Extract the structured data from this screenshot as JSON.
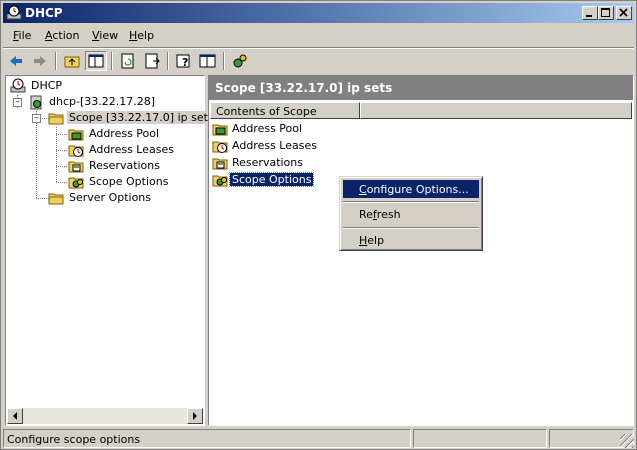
{
  "window": {
    "title": "DHCP"
  },
  "menu": [
    {
      "label": "File",
      "key": "F",
      "rest": "ile"
    },
    {
      "label": "Action",
      "key": "A",
      "rest": "ction"
    },
    {
      "label": "View",
      "key": "V",
      "rest": "iew"
    },
    {
      "label": "Help",
      "key": "H",
      "rest": "elp"
    }
  ],
  "toolbar": {
    "buttons": [
      "back-icon",
      "forward-icon",
      "up-folder-icon",
      "show-hide-tree-icon",
      "refresh-icon",
      "export-list-icon",
      "help-icon",
      "properties-icon",
      "dhcp-server-icon"
    ]
  },
  "tree": {
    "root": "DHCP",
    "server": "dhcp-[33.22.17.28]",
    "scope": "Scope [33.22.17.0] ip sets",
    "scope_children": [
      "Address Pool",
      "Address Leases",
      "Reservations",
      "Scope Options"
    ],
    "server_options": "Server Options"
  },
  "right": {
    "header": "Scope [33.22.17.0] ip sets",
    "column": "Contents of Scope",
    "items": [
      "Address Pool",
      "Address Leases",
      "Reservations",
      "Scope Options"
    ],
    "selected_index": 3
  },
  "context_menu": {
    "items": [
      {
        "pre": "",
        "key": "C",
        "post": "onfigure Options..."
      },
      {
        "pre": "Re",
        "key": "f",
        "post": "resh"
      },
      {
        "pre": "",
        "key": "H",
        "post": "elp"
      }
    ]
  },
  "status": {
    "text": "Configure scope options"
  },
  "colors": {
    "title_start": "#0a246a",
    "title_end": "#a6caf0",
    "selection": "#0a246a",
    "face": "#d4d0c8"
  }
}
